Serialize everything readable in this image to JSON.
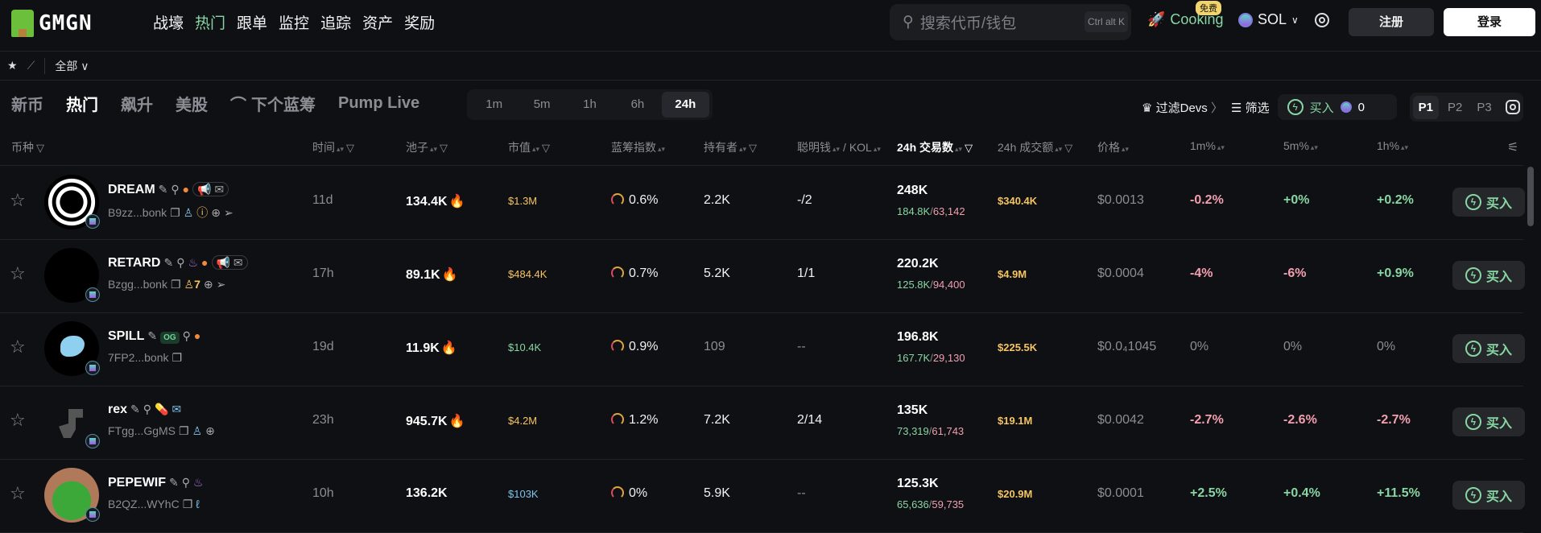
{
  "header": {
    "logo": "GMGN",
    "nav": [
      "战壕",
      "热门",
      "跟单",
      "监控",
      "追踪",
      "资产",
      "奖励"
    ],
    "nav_active": 1,
    "search_placeholder": "搜索代币/钱包",
    "search_shortcut": "Ctrl alt K",
    "cooking": "Cooking",
    "free_badge": "免费",
    "chain": "SOL",
    "register": "注册",
    "login": "登录"
  },
  "subbar": {
    "filter": "全部"
  },
  "tabs": [
    "新币",
    "热门",
    "飙升",
    "美股",
    "下个蓝筹",
    "Pump Live"
  ],
  "tab_active": 1,
  "timeframes": [
    "1m",
    "5m",
    "1h",
    "6h",
    "24h"
  ],
  "tf_active": 4,
  "tools": {
    "filter_devs": "过滤Devs",
    "screen": "筛选",
    "buy": "买入",
    "amount": "0",
    "pages": [
      "P1",
      "P2",
      "P3"
    ],
    "page_active": 0
  },
  "columns": {
    "token": "币种",
    "age": "时间",
    "pool": "池子",
    "mcap": "市值",
    "bluechip": "蓝筹指数",
    "holders": "持有者",
    "smart": "聪明钱",
    "kol": "/ KOL",
    "tx": "24h 交易数",
    "vol": "24h 成交额",
    "price": "价格",
    "m1": "1m%",
    "m5": "5m%",
    "h1": "1h%"
  },
  "rows": [
    {
      "name": "DREAM",
      "addr": "B9zz...bonk",
      "age": "11d",
      "pool": "134.4K",
      "pool_hot": true,
      "mcap": "$1.3M",
      "mcap_color": "y",
      "bluechip": "0.6%",
      "holders": "2.2K",
      "smart": "-/2",
      "tx": "248K",
      "buys": "184.8K",
      "sells": "63,142",
      "vol": "$340.4K",
      "price": "$0.0013",
      "m1": "-0.2%",
      "m5": "+0%",
      "h1": "+0.2%",
      "buy": "买入",
      "extra": ""
    },
    {
      "name": "RETARD",
      "addr": "Bzgg...bonk",
      "age": "17h",
      "pool": "89.1K",
      "pool_hot": true,
      "mcap": "$484.4K",
      "mcap_color": "y",
      "bluechip": "0.7%",
      "holders": "5.2K",
      "smart": "1/1",
      "tx": "220.2K",
      "buys": "125.8K",
      "sells": "94,400",
      "vol": "$4.9M",
      "price": "$0.0004",
      "m1": "-4%",
      "m5": "-6%",
      "h1": "+0.9%",
      "buy": "买入",
      "extra": "7"
    },
    {
      "name": "SPILL",
      "addr": "7FP2...bonk",
      "age": "19d",
      "pool": "11.9K",
      "pool_hot": true,
      "mcap": "$10.4K",
      "mcap_color": "g",
      "bluechip": "0.9%",
      "holders": "109",
      "smart": "--",
      "tx": "196.8K",
      "buys": "167.7K",
      "sells": "29,130",
      "vol": "$225.5K",
      "price": "$0.0₄1045",
      "m1": "0%",
      "m5": "0%",
      "h1": "0%",
      "buy": "买入",
      "extra": "OG"
    },
    {
      "name": "rex",
      "addr": "FTgg...GgMS",
      "age": "23h",
      "pool": "945.7K",
      "pool_hot": true,
      "mcap": "$4.2M",
      "mcap_color": "y",
      "bluechip": "1.2%",
      "holders": "7.2K",
      "smart": "2/14",
      "tx": "135K",
      "buys": "73,319",
      "sells": "61,743",
      "vol": "$19.1M",
      "price": "$0.0042",
      "m1": "-2.7%",
      "m5": "-2.6%",
      "h1": "-2.7%",
      "buy": "买入",
      "extra": ""
    },
    {
      "name": "PEPEWIF",
      "addr": "B2QZ...WYhC",
      "age": "10h",
      "pool": "136.2K",
      "pool_hot": false,
      "mcap": "$103K",
      "mcap_color": "bl",
      "bluechip": "0%",
      "holders": "5.9K",
      "smart": "--",
      "tx": "125.3K",
      "buys": "65,636",
      "sells": "59,735",
      "vol": "$20.9M",
      "price": "$0.0001",
      "m1": "+2.5%",
      "m5": "+0.4%",
      "h1": "+11.5%",
      "buy": "买入",
      "extra": ""
    }
  ]
}
